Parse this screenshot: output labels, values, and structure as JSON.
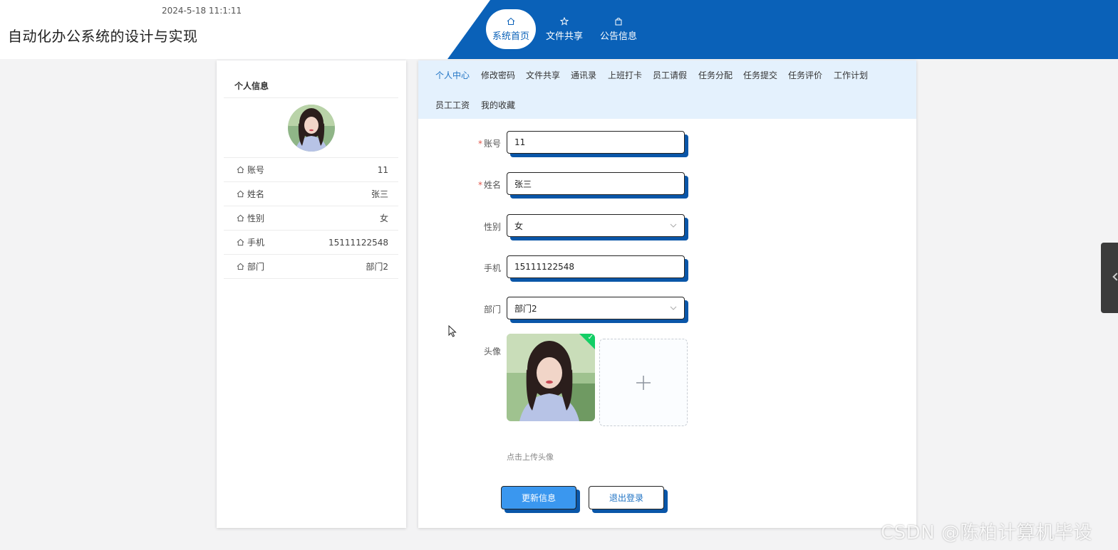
{
  "header": {
    "datetime": "2024-5-18 11:1:11",
    "title": "自动化办公系统的设计与实现",
    "nav": [
      {
        "label": "系统首页",
        "icon": "home-icon",
        "active": true
      },
      {
        "label": "文件共享",
        "icon": "star-icon",
        "active": false
      },
      {
        "label": "公告信息",
        "icon": "bag-icon",
        "active": false
      }
    ]
  },
  "profile_card": {
    "title": "个人信息",
    "rows": [
      {
        "label": "账号",
        "value": "11"
      },
      {
        "label": "姓名",
        "value": "张三"
      },
      {
        "label": "性别",
        "value": "女"
      },
      {
        "label": "手机",
        "value": "15111122548"
      },
      {
        "label": "部门",
        "value": "部门2"
      }
    ]
  },
  "tabs": [
    {
      "label": "个人中心",
      "active": true
    },
    {
      "label": "修改密码"
    },
    {
      "label": "文件共享"
    },
    {
      "label": "通讯录"
    },
    {
      "label": "上班打卡"
    },
    {
      "label": "员工请假"
    },
    {
      "label": "任务分配"
    },
    {
      "label": "任务提交"
    },
    {
      "label": "任务评价"
    },
    {
      "label": "工作计划"
    },
    {
      "label": "员工工资"
    },
    {
      "label": "我的收藏"
    }
  ],
  "form": {
    "account": {
      "label": "账号",
      "value": "11",
      "required": true
    },
    "name": {
      "label": "姓名",
      "value": "张三",
      "required": true
    },
    "gender": {
      "label": "性别",
      "value": "女"
    },
    "phone": {
      "label": "手机",
      "value": "15111122548"
    },
    "department": {
      "label": "部门",
      "value": "部门2"
    },
    "avatar": {
      "label": "头像",
      "hint": "点击上传头像"
    }
  },
  "buttons": {
    "update": "更新信息",
    "logout": "退出登录"
  },
  "watermark": "CSDN @陈柏计算机毕设",
  "colors": {
    "brand_blue": "#0a61b8",
    "tab_bg": "#e4f1fd",
    "primary_button": "#3a97ef",
    "success": "#13ce66"
  }
}
